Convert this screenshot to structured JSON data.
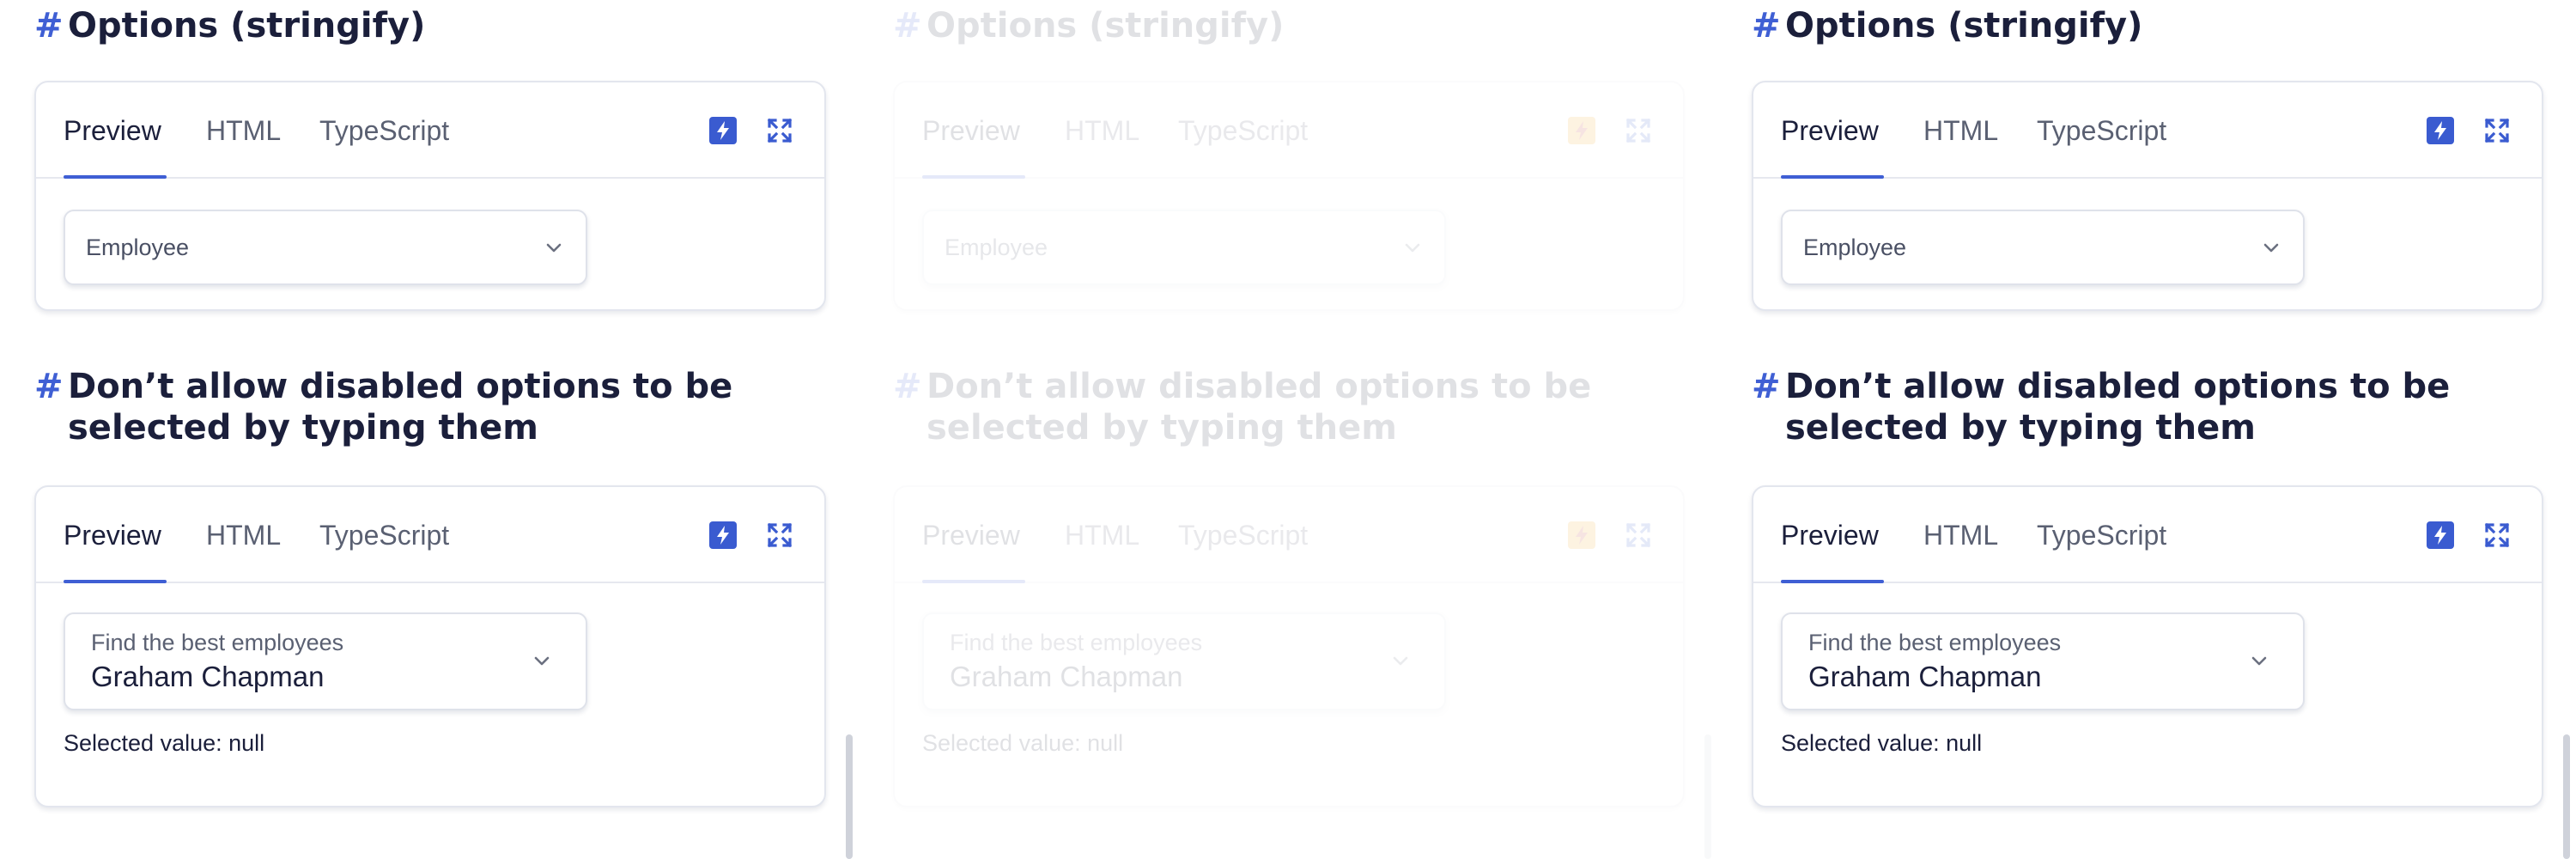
{
  "sections": [
    {
      "hash": "#",
      "title": "Options (stringify)",
      "tabs": [
        "Preview",
        "HTML",
        "TypeScript"
      ],
      "active_tab": "Preview",
      "select_placeholder": "Employee"
    },
    {
      "hash": "#",
      "title": "Don’t allow disabled options to be selected by typing them",
      "tabs": [
        "Preview",
        "HTML",
        "TypeScript"
      ],
      "active_tab": "Preview",
      "select_label": "Find the best employees",
      "select_value": "Graham Chapman",
      "selected_value_text": "Selected value: null"
    }
  ],
  "icons": {
    "stackblitz": "lightning-bolt-icon",
    "fullscreen": "expand-icon",
    "dropdown": "chevron-down-icon"
  },
  "colors": {
    "accent": "#3f5fd4",
    "text": "#1b1f3b",
    "muted": "#5a6072",
    "border": "#e3e6ee",
    "highlight_bolt": "#f5a623"
  }
}
